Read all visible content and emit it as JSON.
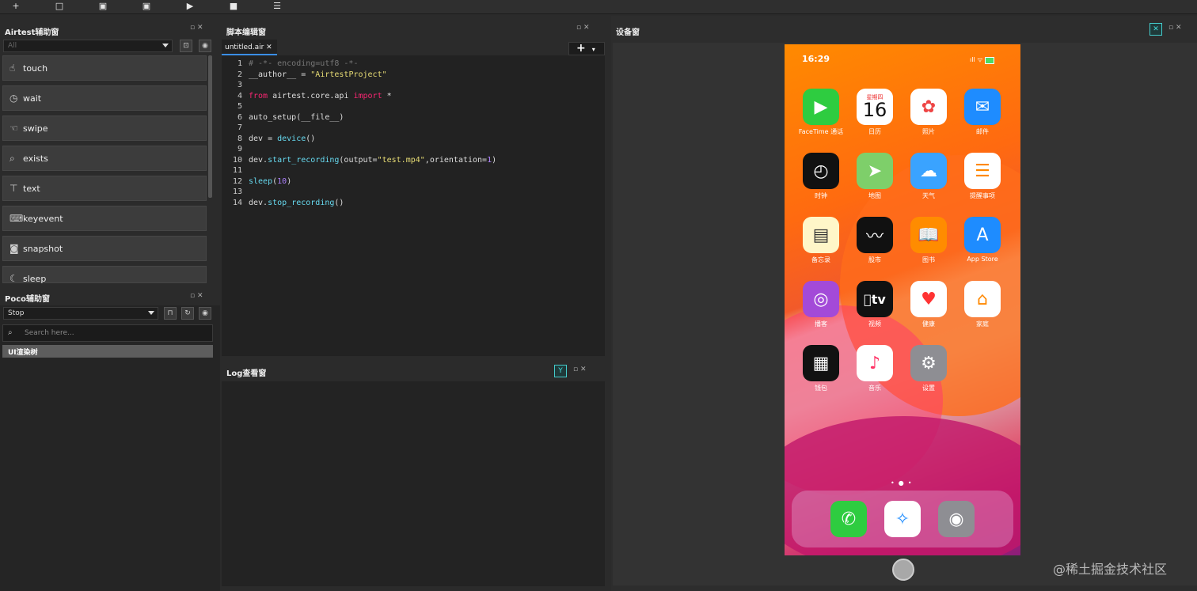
{
  "toolbar": {
    "new": "+",
    "open": "■",
    "save": "▣",
    "saveas": "▣",
    "run": "▶",
    "stop": "■",
    "log": "☰"
  },
  "airtest": {
    "title": "Airtest辅助窗",
    "filter": "All",
    "apis": [
      {
        "label": "touch",
        "icon": "hand-icon"
      },
      {
        "label": "wait",
        "icon": "clock-icon"
      },
      {
        "label": "swipe",
        "icon": "swipe-icon"
      },
      {
        "label": "exists",
        "icon": "magnifier-icon"
      },
      {
        "label": "text",
        "icon": "text-icon"
      },
      {
        "label": "keyevent",
        "icon": "keyboard-icon"
      },
      {
        "label": "snapshot",
        "icon": "camera-icon"
      },
      {
        "label": "sleep",
        "icon": "moon-icon"
      }
    ]
  },
  "poco": {
    "title": "Poco辅助窗",
    "mode": "Stop",
    "search_placeholder": "Search here...",
    "tree_root": "UI渲染树"
  },
  "editor": {
    "title": "脚本编辑窗",
    "tab": "untitled.air",
    "lines": [
      "1",
      "2",
      "3",
      "4",
      "5",
      "6",
      "7",
      "8",
      "9",
      "10",
      "11",
      "12",
      "13",
      "14"
    ]
  },
  "log": {
    "title": "Log查看窗"
  },
  "device": {
    "title": "设备窗",
    "time": "16:29",
    "calendar_day": "星期四",
    "calendar_date": "16",
    "apps": [
      {
        "label": "FaceTime 通话",
        "color": "#2ecc40"
      },
      {
        "label": "日历",
        "color": "#ffffff"
      },
      {
        "label": "照片",
        "color": "#ffffff"
      },
      {
        "label": "邮件",
        "color": "#1e8cff"
      },
      {
        "label": "时钟",
        "color": "#111111"
      },
      {
        "label": "地图",
        "color": "#7ecf6a"
      },
      {
        "label": "天气",
        "color": "#3aa3ff"
      },
      {
        "label": "提醒事项",
        "color": "#ffffff"
      },
      {
        "label": "备忘录",
        "color": "#fff6c8"
      },
      {
        "label": "股市",
        "color": "#111111"
      },
      {
        "label": "图书",
        "color": "#ff8c00"
      },
      {
        "label": "App Store",
        "color": "#1e8cff"
      },
      {
        "label": "播客",
        "color": "#a34ad8"
      },
      {
        "label": "视频",
        "color": "#111111"
      },
      {
        "label": "健康",
        "color": "#ffffff"
      },
      {
        "label": "家庭",
        "color": "#ffffff"
      },
      {
        "label": "钱包",
        "color": "#111111"
      },
      {
        "label": "音乐",
        "color": "#ffffff"
      },
      {
        "label": "设置",
        "color": "#8e8e93"
      }
    ],
    "tv_text": "tv"
  },
  "watermark": "@稀土掘金技术社区"
}
